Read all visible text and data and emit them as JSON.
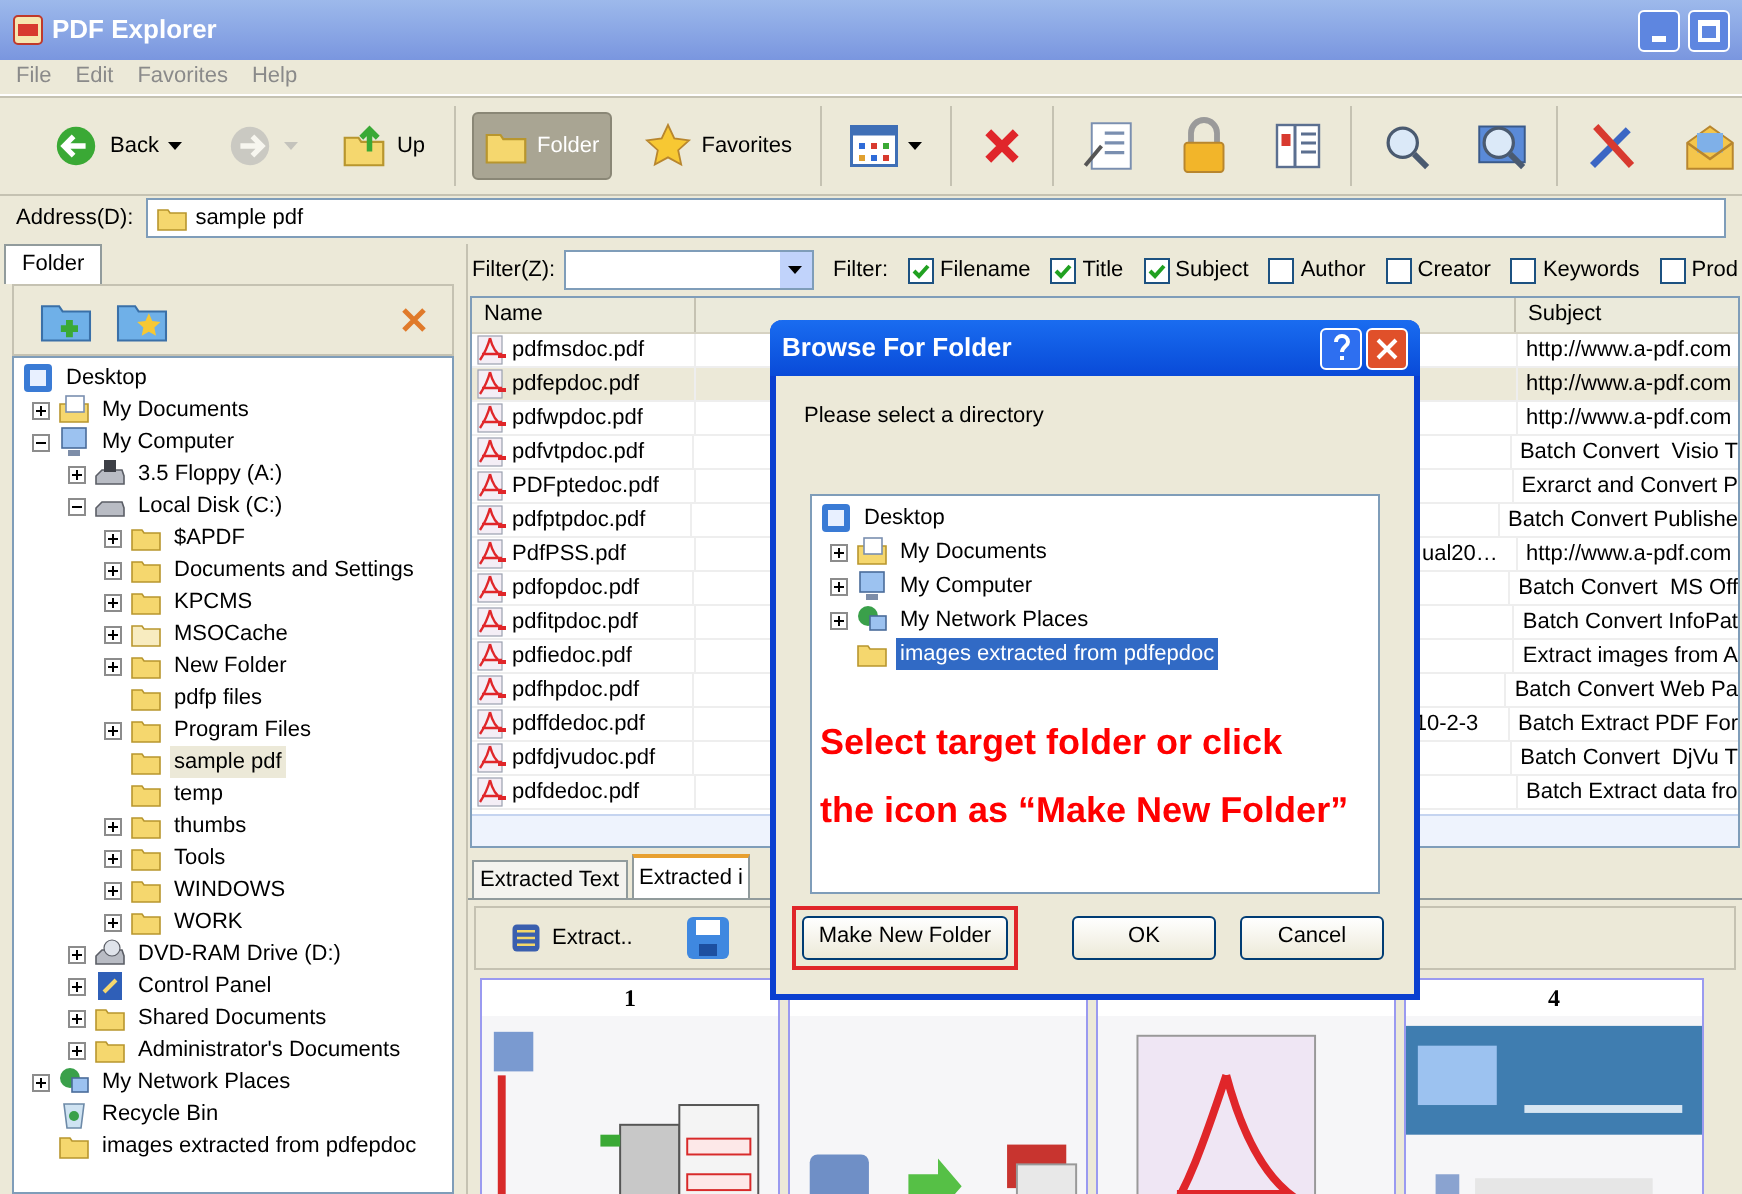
{
  "window": {
    "title": "PDF Explorer"
  },
  "menu": [
    "File",
    "Edit",
    "Favorites",
    "Help"
  ],
  "toolbar": [
    {
      "kind": "back",
      "label": "Back",
      "pressed": false,
      "disabled": false,
      "dropdown": true
    },
    {
      "kind": "forward",
      "pressed": false,
      "disabled": true,
      "dropdown": true
    },
    {
      "kind": "up",
      "label": "Up",
      "pressed": false,
      "disabled": false,
      "dropdown": false
    },
    {
      "kind": "folder",
      "label": "Folder",
      "pressed": true,
      "disabled": false,
      "dropdown": false
    },
    {
      "kind": "favorites",
      "label": "Favorites",
      "pressed": false,
      "disabled": false,
      "dropdown": false
    },
    {
      "kind": "views",
      "pressed": false,
      "disabled": false,
      "dropdown": true
    },
    {
      "kind": "delete",
      "pressed": false,
      "disabled": false,
      "dropdown": false
    },
    {
      "kind": "properties",
      "pressed": false,
      "disabled": false,
      "dropdown": false
    },
    {
      "kind": "lock",
      "pressed": false,
      "disabled": false,
      "dropdown": false
    },
    {
      "kind": "columns",
      "pressed": false,
      "disabled": false,
      "dropdown": false
    },
    {
      "kind": "search",
      "pressed": false,
      "disabled": false,
      "dropdown": false
    },
    {
      "kind": "image-search",
      "pressed": false,
      "disabled": false,
      "dropdown": false
    },
    {
      "kind": "tools",
      "pressed": false,
      "disabled": false,
      "dropdown": false
    },
    {
      "kind": "mail",
      "pressed": false,
      "disabled": false,
      "dropdown": false
    }
  ],
  "address": {
    "label": "Address(D):",
    "value": "sample pdf"
  },
  "folder_pane": {
    "tab": "Folder",
    "tree": [
      {
        "label": "Desktop",
        "kind": "desktop",
        "selected": false,
        "children": [
          {
            "label": "My Documents",
            "kind": "documents",
            "expanded": false,
            "selected": false
          },
          {
            "label": "My Computer",
            "kind": "computer",
            "expanded": true,
            "selected": false,
            "children": [
              {
                "label": "3.5 Floppy (A:)",
                "kind": "floppy",
                "expanded": false,
                "selected": false
              },
              {
                "label": "Local Disk (C:)",
                "kind": "disk",
                "expanded": true,
                "selected": false,
                "children": [
                  {
                    "label": "$APDF",
                    "kind": "folder",
                    "expanded": false,
                    "selected": false
                  },
                  {
                    "label": "Documents and Settings",
                    "kind": "folder",
                    "expanded": false,
                    "selected": false
                  },
                  {
                    "label": "KPCMS",
                    "kind": "folder",
                    "expanded": false,
                    "selected": false
                  },
                  {
                    "label": "MSOCache",
                    "kind": "hidden-folder",
                    "expanded": false,
                    "selected": false
                  },
                  {
                    "label": "New Folder",
                    "kind": "folder",
                    "expanded": false,
                    "selected": false
                  },
                  {
                    "label": "pdfp files",
                    "kind": "folder",
                    "selected": false
                  },
                  {
                    "label": "Program Files",
                    "kind": "folder",
                    "expanded": false,
                    "selected": false
                  },
                  {
                    "label": "sample pdf",
                    "kind": "folder",
                    "selected": true
                  },
                  {
                    "label": "temp",
                    "kind": "folder",
                    "selected": false
                  },
                  {
                    "label": "thumbs",
                    "kind": "folder",
                    "expanded": false,
                    "selected": false
                  },
                  {
                    "label": "Tools",
                    "kind": "folder",
                    "expanded": false,
                    "selected": false
                  },
                  {
                    "label": "WINDOWS",
                    "kind": "folder",
                    "expanded": false,
                    "selected": false
                  },
                  {
                    "label": "WORK",
                    "kind": "folder",
                    "expanded": false,
                    "selected": false
                  }
                ]
              },
              {
                "label": "DVD-RAM Drive (D:)",
                "kind": "dvd",
                "expanded": false,
                "selected": false
              },
              {
                "label": "Control Panel",
                "kind": "control-panel",
                "expanded": false,
                "selected": false
              },
              {
                "label": "Shared Documents",
                "kind": "folder",
                "expanded": false,
                "selected": false
              },
              {
                "label": "Administrator's Documents",
                "kind": "folder",
                "expanded": false,
                "selected": false
              }
            ]
          },
          {
            "label": "My Network Places",
            "kind": "network",
            "expanded": false,
            "selected": false
          },
          {
            "label": "Recycle Bin",
            "kind": "recycle",
            "selected": false
          },
          {
            "label": "images extracted from pdfepdoc",
            "kind": "folder",
            "selected": false
          }
        ]
      }
    ]
  },
  "filter": {
    "label": "Filter(Z):",
    "fields_label": "Filter:",
    "fields": [
      {
        "label": "Filename",
        "checked": true
      },
      {
        "label": "Title",
        "checked": true
      },
      {
        "label": "Subject",
        "checked": true
      },
      {
        "label": "Author",
        "checked": false
      },
      {
        "label": "Creator",
        "checked": false
      },
      {
        "label": "Keywords",
        "checked": false
      },
      {
        "label": "Prod",
        "checked": false
      }
    ]
  },
  "file_list": {
    "columns": [
      "Name",
      "Subject"
    ],
    "rows": [
      {
        "name": "pdfmsdoc.pdf",
        "subject": "http://www.a-pdf.com",
        "selected": false
      },
      {
        "name": "pdfepdoc.pdf",
        "subject": "http://www.a-pdf.com",
        "selected": true
      },
      {
        "name": "pdfwpdoc.pdf",
        "subject": "http://www.a-pdf.com",
        "selected": false
      },
      {
        "name": "pdfvtpdoc.pdf",
        "subject": "Batch Convert  Visio T",
        "selected": false
      },
      {
        "name": "PDFptedoc.pdf",
        "subject": "Exrarct and Convert P",
        "selected": false
      },
      {
        "name": "pdfptpdoc.pdf",
        "subject": "Batch Convert Publishe",
        "selected": false
      },
      {
        "name": "PdfPSS.pdf",
        "column_3": "ual20…",
        "subject": "http://www.a-pdf.com",
        "selected": false
      },
      {
        "name": "pdfopdoc.pdf",
        "subject": "Batch Convert  MS Off",
        "selected": false
      },
      {
        "name": "pdfitpdoc.pdf",
        "subject": "Batch Convert InfoPat",
        "selected": false
      },
      {
        "name": "pdfiedoc.pdf",
        "subject": "Extract images from A",
        "selected": false
      },
      {
        "name": "pdfhpdoc.pdf",
        "subject": "Batch Convert Web Pa",
        "selected": false
      },
      {
        "name": "pdffdedoc.pdf",
        "column_3": "10-2-3",
        "subject": "Batch Extract PDF For",
        "selected": false
      },
      {
        "name": "pdfdjvudoc.pdf",
        "subject": "Batch Convert  DjVu T",
        "selected": false
      },
      {
        "name": "pdfdedoc.pdf",
        "subject": "Batch Extract data fro",
        "selected": false
      }
    ]
  },
  "bottom_tabs": [
    {
      "label": "Extracted Text",
      "selected": false
    },
    {
      "label": "Extracted i",
      "selected": true
    }
  ],
  "extract_toolbar": {
    "extract": "Extract.."
  },
  "thumbnails": [
    {
      "label": "1",
      "kind": "picture"
    },
    {
      "kind": "picture"
    },
    {
      "kind": "picture"
    },
    {
      "label": "4",
      "kind": "picture"
    }
  ],
  "dialog": {
    "title": "Browse For Folder",
    "prompt": "Please select a directory",
    "tree": [
      {
        "label": "Desktop",
        "kind": "desktop",
        "selected": false,
        "children": [
          {
            "label": "My Documents",
            "kind": "documents",
            "expanded": false,
            "selected": false
          },
          {
            "label": "My Computer",
            "kind": "computer",
            "expanded": false,
            "selected": false
          },
          {
            "label": "My Network Places",
            "kind": "network",
            "expanded": false,
            "selected": false
          },
          {
            "label": "images extracted from pdfepdoc",
            "kind": "folder",
            "selected": true
          }
        ]
      }
    ],
    "annotation": [
      "Select target folder or click",
      "the icon as “Make New Folder”"
    ],
    "buttons": [
      {
        "label": "Make New Folder",
        "highlighted": true
      },
      {
        "label": "OK",
        "highlighted": false
      },
      {
        "label": "Cancel",
        "highlighted": false
      }
    ]
  }
}
